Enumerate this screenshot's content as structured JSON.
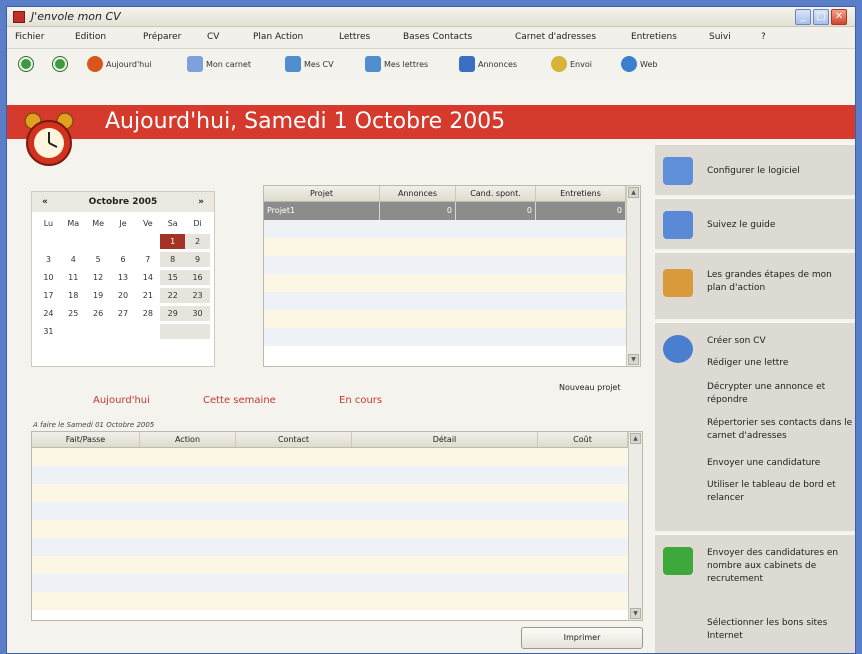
{
  "window": {
    "title": "J'envole mon CV"
  },
  "menu": [
    "Fichier",
    "Edition",
    "Préparer",
    "CV",
    "Plan Action",
    "Lettres",
    "Bases Contacts",
    "Carnet d'adresses",
    "Entretiens",
    "Suivi",
    "?"
  ],
  "toolbar": {
    "back_icon": "back-arrow-icon",
    "forward_icon": "forward-arrow-icon",
    "buttons": [
      {
        "label": "Aujourd'hui",
        "icon": "clock-icon",
        "color": "#d8561c"
      },
      {
        "label": "Mon carnet",
        "icon": "notebook-icon",
        "color": "#7fa0d8"
      },
      {
        "label": "Mes CV",
        "icon": "cv-icon",
        "color": "#4f8fd0"
      },
      {
        "label": "Mes lettres",
        "icon": "letters-icon",
        "color": "#4f8fd0"
      },
      {
        "label": "Annonces",
        "icon": "annonces-icon",
        "color": "#3a6fc2"
      },
      {
        "label": "Envoi",
        "icon": "send-icon",
        "color": "#d8b23a"
      },
      {
        "label": "Web",
        "icon": "globe-icon",
        "color": "#3a7fd0"
      }
    ]
  },
  "banner": {
    "title": "Aujourd'hui, Samedi 1 Octobre 2005",
    "color": "#d63a2c"
  },
  "calendar": {
    "month": "Octobre 2005",
    "prev": "«",
    "next": "»",
    "weekdays": [
      "Lu",
      "Ma",
      "Me",
      "Je",
      "Ve",
      "Sa",
      "Di"
    ],
    "weeks": [
      [
        "",
        "",
        "",
        "",
        "",
        "1",
        "2"
      ],
      [
        "3",
        "4",
        "5",
        "6",
        "7",
        "8",
        "9"
      ],
      [
        "10",
        "11",
        "12",
        "13",
        "14",
        "15",
        "16"
      ],
      [
        "17",
        "18",
        "19",
        "20",
        "21",
        "22",
        "23"
      ],
      [
        "24",
        "25",
        "26",
        "27",
        "28",
        "29",
        "30"
      ],
      [
        "31",
        "",
        "",
        "",
        "",
        "",
        ""
      ]
    ],
    "today": "1"
  },
  "projects_grid": {
    "columns": [
      "Projet",
      "Annonces",
      "Cand. spont.",
      "Entretiens"
    ],
    "rows": [
      [
        "Projet1",
        "0",
        "0",
        "0"
      ]
    ]
  },
  "tabs": [
    "Aujourd'hui",
    "Cette semaine",
    "En cours"
  ],
  "new_project": "Nouveau projet",
  "tasks_grid": {
    "caption": "A faire le Samedi 01 Octobre 2005",
    "columns": [
      "Fait/Passe",
      "Action",
      "Contact",
      "Détail",
      "Coût"
    ]
  },
  "print_button": "Imprimer",
  "right_panel": {
    "blocks": [
      {
        "icon": "config-icon",
        "items": [
          "Configurer le logiciel"
        ]
      },
      {
        "icon": "guide-icon",
        "items": [
          "Suivez le guide"
        ]
      },
      {
        "icon": "steps-icon",
        "items": [
          "Les grandes étapes de mon plan d'action"
        ]
      },
      {
        "icon": "cv-create-icon",
        "items": [
          "Créer son CV",
          "Rédiger une lettre",
          "Décrypter une annonce et répondre",
          "Répertorier ses contacts dans le carnet d'adresses",
          "Envoyer une candidature",
          "Utiliser le tableau de bord et relancer"
        ]
      },
      {
        "icon": "send-many-icon",
        "items": [
          "Envoyer des candidatures en nombre aux cabinets de recrutement",
          "Sélectionner les bons sites Internet"
        ]
      }
    ]
  }
}
